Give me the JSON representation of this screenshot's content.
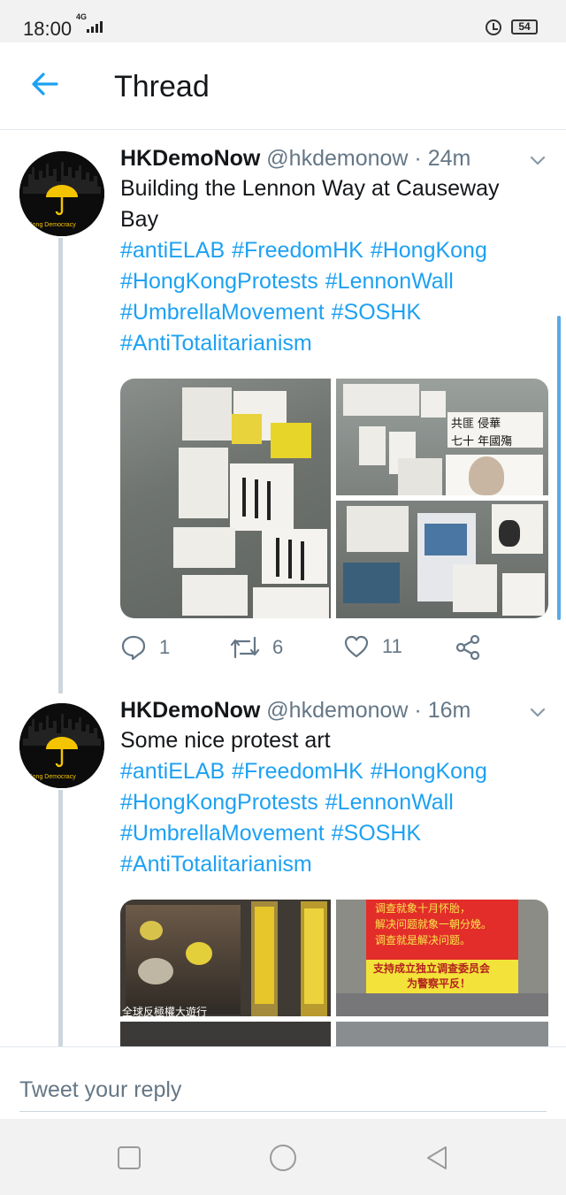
{
  "status_bar": {
    "time": "18:00",
    "network": "4G",
    "battery": "54"
  },
  "header": {
    "title": "Thread",
    "back_icon": "arrow-left-icon"
  },
  "colors": {
    "accent": "#1da1f2",
    "text": "#14171a",
    "secondary": "#657786",
    "thread_line": "#ccd6dd"
  },
  "tweets": [
    {
      "display_name": "HKDemoNow",
      "meta": "@hkdemonow · 24m",
      "text": "Building the Lennon Way at Causeway Bay",
      "avatar_caption": "Kong Democracy",
      "hashtags": [
        "#antiELAB",
        "#FreedomHK",
        "#HongKong",
        "#HongKongProtests",
        "#LennonWall",
        "#UmbrellaMovement",
        "#SOSHK",
        "#AntiTotalitarianism"
      ],
      "photo_text": {
        "banner_top": "共匪 侵華",
        "banner_bottom": "七十 年國殤"
      },
      "replies": "1",
      "retweets": "6",
      "likes": "11"
    },
    {
      "display_name": "HKDemoNow",
      "meta": "@hkdemonow · 16m",
      "text": "Some nice protest art",
      "avatar_caption": "Kong Democracy",
      "hashtags": [
        "#antiELAB",
        "#FreedomHK",
        "#HongKong",
        "#HongKongProtests",
        "#LennonWall",
        "#UmbrellaMovement",
        "#SOSHK",
        "#AntiTotalitarianism"
      ],
      "photo_text": {
        "red_sign": [
          "调查就象十月怀胎，",
          "解决问题就象一朝分娩。",
          "调查就是解决问题。"
        ],
        "yellow_sign": [
          "支持成立独立调查委员会",
          "为警察平反！"
        ],
        "poster_caption": "全球反極權大遊行"
      }
    }
  ],
  "reply_bar": {
    "placeholder": "Tweet your reply"
  },
  "nav_bar": {
    "buttons": [
      "recent-apps-icon",
      "home-icon",
      "back-triangle-icon"
    ]
  }
}
